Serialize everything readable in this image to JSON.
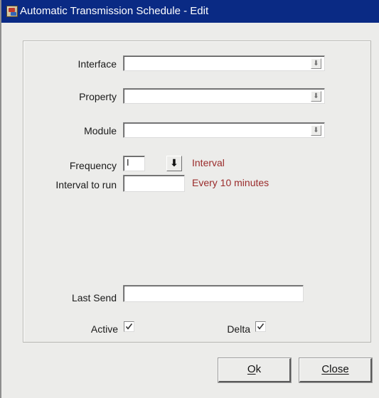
{
  "window": {
    "title": "Automatic Transmission Schedule - Edit"
  },
  "form": {
    "interface": {
      "label": "Interface",
      "value": ""
    },
    "property": {
      "label": "Property",
      "value": ""
    },
    "module": {
      "label": "Module",
      "value": ""
    },
    "frequency": {
      "label": "Frequency",
      "value": "I",
      "description": "Interval"
    },
    "interval_to_run": {
      "label": "Interval to run",
      "value": "",
      "description": "Every 10 minutes"
    },
    "last_send": {
      "label": "Last Send",
      "value": ""
    },
    "active": {
      "label": "Active",
      "checked": true
    },
    "delta": {
      "label": "Delta",
      "checked": true
    }
  },
  "buttons": {
    "ok_mnemonic": "O",
    "ok_rest": "k",
    "close_label": "Close"
  },
  "icons": {
    "dropdown": "arrow-down-icon",
    "app": "app-icon",
    "check": "checkmark-icon"
  },
  "colors": {
    "titlebar": "#0a2a84",
    "window_bg": "#ececea",
    "description_text": "#9a2b2b"
  }
}
